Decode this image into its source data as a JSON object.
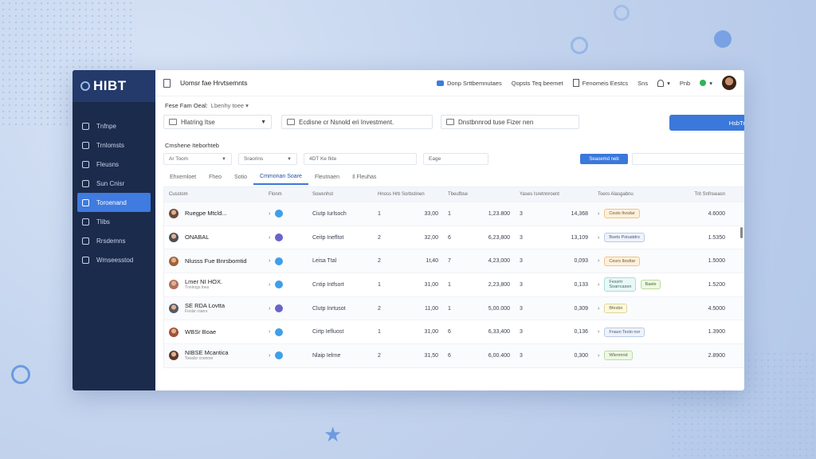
{
  "app": {
    "logo": "HIBT",
    "title": "Uomsr fae Hrvtsemnts"
  },
  "topbar": {
    "link1": "Donp Srttbemnutaes",
    "link2": "Qopsts Teq beemet",
    "link3": "Fenomeis Eestcs",
    "link4": "Sns",
    "user_caret": "▾",
    "pnb": "Pnb",
    "green_caret": "▾"
  },
  "sidebar": {
    "items": [
      {
        "label": "Tnfnpe",
        "icon": "screen-icon"
      },
      {
        "label": "Trnlomsts",
        "icon": "folder-icon"
      },
      {
        "label": "Fleusns",
        "icon": "document-icon"
      },
      {
        "label": "Sun Cnisr",
        "icon": "calendar-icon"
      },
      {
        "label": "Toroenand",
        "icon": "chart-icon",
        "active": true
      },
      {
        "label": "Tlibs",
        "icon": "list-icon"
      },
      {
        "label": "Rrsdemns",
        "icon": "gear-icon"
      },
      {
        "label": "Wmseesstod",
        "icon": "chat-icon"
      }
    ]
  },
  "filters": {
    "label": "Fese Fam Oeal:",
    "label_select": "Lbenhy toee ▾",
    "field1": "Hlatring Itse",
    "field2": "Ecdisne cr Nsnold eri Investment.",
    "field3": "Dnstbnnrod tuse Fizer nen",
    "button": "HsbTreat"
  },
  "section": {
    "label": "Cmshene Iteborhteb",
    "sfield1": "Ar Toom",
    "sfield2": "Sraorins",
    "sfield3": "4DT Ke fkte",
    "sfield4": "Eage",
    "button": "Seaoemd neb"
  },
  "tabs": [
    {
      "label": "Ehxemloet",
      "active": false
    },
    {
      "label": "Fheo",
      "active": false
    },
    {
      "label": "Sotio",
      "active": false
    },
    {
      "label": "Cmmonan Soare",
      "active": true
    },
    {
      "label": "Fleutnaen",
      "active": false
    },
    {
      "label": "Il Fleuhas",
      "active": false
    }
  ],
  "table": {
    "headers": [
      "Cusstom",
      "Flonm",
      "Sowsnhst",
      "Hnoss Hrb Sorbstinen",
      "Tbeufbse",
      "Yases Isretnnroent",
      "Toero Alasgabnu",
      "Trit Snfnseasn"
    ],
    "rows": [
      {
        "name": "Ruegpe Mtcld...",
        "sub": "",
        "face": "#6b4a3a",
        "dot": "#3f9fe8",
        "type": "Ciutp Iurlsoch",
        "a": "1",
        "b": "33,00",
        "c": "1",
        "d": "1,23.800",
        "e": "3",
        "f": "14,368",
        "tag": "Ceuts Itvsdar",
        "tagc": "tag-o",
        "extra": "",
        "total": "4.6000"
      },
      {
        "name": "ONABAL",
        "sub": "",
        "face": "#4a4f58",
        "dot": "#6a63c9",
        "type": "Ceitp Inefltot",
        "a": "2",
        "b": "32,00",
        "c": "6",
        "d": "6,23,800",
        "e": "3",
        "f": "13,109",
        "tag": "Bsets Pstuatdrs",
        "tagc": "tag-b",
        "extra": "",
        "total": "1.5350"
      },
      {
        "name": "Nlusss Fue Bnrsbomtid",
        "sub": "",
        "face": "#a0603a",
        "dot": "#3f9fe8",
        "type": "Leisa Ttal",
        "a": "2",
        "b": "1t,40",
        "c": "7",
        "d": "4,23,000",
        "e": "3",
        "f": "0,093",
        "tag": "Ceurs Ibsdtar",
        "tagc": "tag-o",
        "extra": "",
        "total": "1.5000"
      },
      {
        "name": "Lmer NI HOX.",
        "sub": "Tnnlrogs tnes",
        "face": "#b07060",
        "dot": "#3f9fe8",
        "type": "Cntip Intfsort",
        "a": "1",
        "b": "31,00",
        "c": "1",
        "d": "2,23,800",
        "e": "3",
        "f": "0,133",
        "tag": "Fessrtr Soarrcasen",
        "tagc": "tag-t",
        "extra": "Baele",
        "total": "1.5200"
      },
      {
        "name": "SE RDA Lovtta",
        "sub": "Fonlsr roarrs",
        "face": "#555a66",
        "dot": "#6a63c9",
        "type": "Clutp Inrtusot",
        "a": "2",
        "b": "11,00",
        "c": "1",
        "d": "5,00.000",
        "e": "3",
        "f": "0,309",
        "tag": "Bfesbn",
        "tagc": "tag-y",
        "extra": "",
        "total": "4.5000"
      },
      {
        "name": "WBSr Boae",
        "sub": "",
        "face": "#a0503a",
        "dot": "#3f9fe8",
        "type": "Cirtp Iefluost",
        "a": "1",
        "b": "31,00",
        "c": "6",
        "d": "6,33,400",
        "e": "3",
        "f": "0,136",
        "tag": "Fnasn Teslo nor",
        "tagc": "tag-b",
        "extra": "",
        "total": "1.3900"
      },
      {
        "name": "NIBSE Mcantica",
        "sub": "Toealsr cnonrsn",
        "face": "#5a3a2a",
        "dot": "#3f9fe8",
        "type": "Nlaip Ielrne",
        "a": "2",
        "b": "31,50",
        "c": "6",
        "d": "6,00.400",
        "e": "3",
        "f": "0,300",
        "tag": "Wlenmnd",
        "tagc": "tag-g",
        "extra": "",
        "total": "2.8900"
      }
    ]
  }
}
